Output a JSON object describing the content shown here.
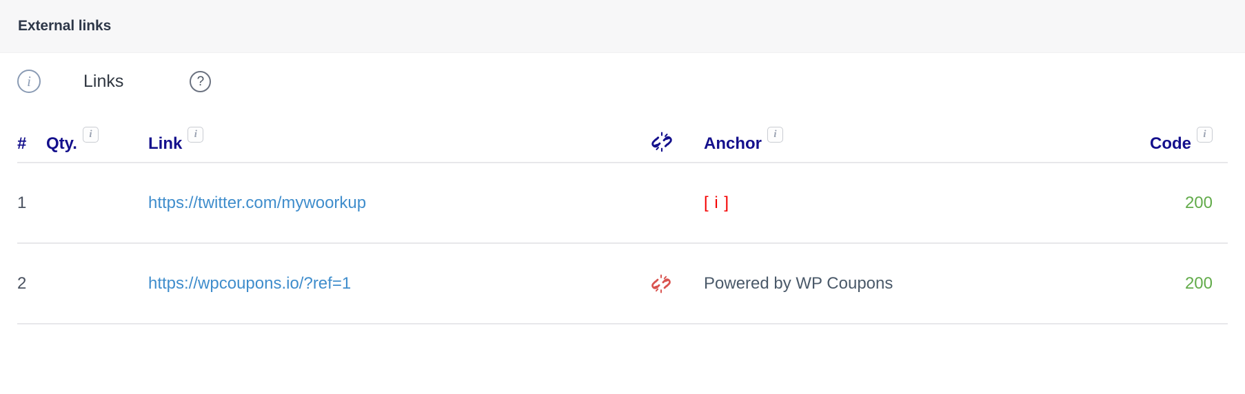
{
  "card": {
    "title": "External links"
  },
  "subheader": {
    "info_icon": "info-circle-icon",
    "label": "Links",
    "help_icon": "help-circle-icon",
    "help_glyph": "?",
    "info_glyph": "i"
  },
  "table": {
    "columns": [
      {
        "key": "num",
        "label": "#",
        "has_info_badge": false
      },
      {
        "key": "qty",
        "label": "Qty.",
        "has_info_badge": true
      },
      {
        "key": "link",
        "label": "Link",
        "has_info_badge": true
      },
      {
        "key": "status",
        "label": "",
        "has_info_badge": false,
        "icon": "broken-link-icon"
      },
      {
        "key": "anchor",
        "label": "Anchor",
        "has_info_badge": true
      },
      {
        "key": "code",
        "label": "Code",
        "has_info_badge": true
      }
    ],
    "badge_glyph": "i",
    "rows": [
      {
        "num": "1",
        "qty": "",
        "link": "https://twitter.com/mywoorkup",
        "status_icon": "none",
        "anchor": "[ i ]",
        "anchor_state": "missing",
        "code": "200"
      },
      {
        "num": "2",
        "qty": "",
        "link": "https://wpcoupons.io/?ref=1",
        "status_icon": "broken-link-icon",
        "anchor": "Powered by WP Coupons",
        "anchor_state": "normal",
        "code": "200"
      }
    ]
  },
  "colors": {
    "header_bar_bg": "#f7f7f8",
    "title_text": "#2d3748",
    "column_header_text": "#14108c",
    "link_text": "#3f8dcc",
    "anchor_text": "#4a5969",
    "missing_anchor_text": "#f40000",
    "code_text": "#62ab4a",
    "broken_link_header_icon": "#14108c",
    "broken_link_row_icon": "#d9534f",
    "divider": "#e7e7ea"
  }
}
